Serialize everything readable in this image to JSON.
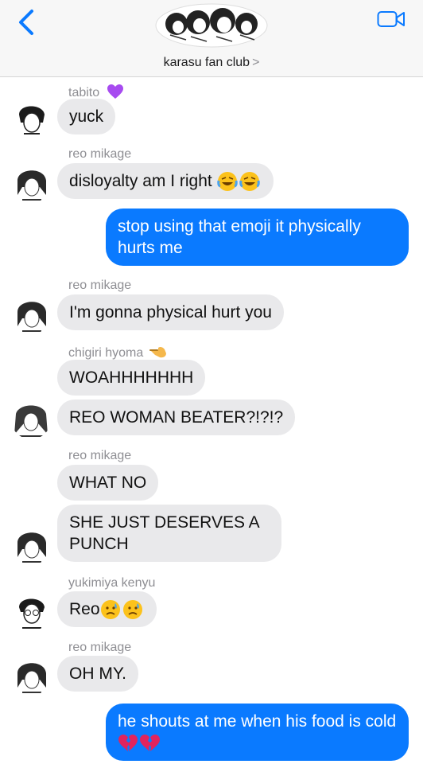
{
  "header": {
    "title": "karasu fan club",
    "chevron": ">",
    "icons": [
      "chevron-left-icon",
      "video-camera-icon"
    ]
  },
  "messages": [
    {
      "sender": "tabito",
      "sender_emoji": "purple-heart",
      "text": "yuck"
    },
    {
      "sender": "reo mikage",
      "text": "disloyalty am I right",
      "emoji": "tears-of-joy x2"
    },
    {
      "outgoing": true,
      "text": "stop using that emoji it physically hurts me"
    },
    {
      "sender": "reo mikage",
      "text": "I'm gonna physical hurt you"
    },
    {
      "sender": "chigiri hyoma",
      "sender_emoji": "pointing-hand",
      "text": "WOAHHHHHHH"
    },
    {
      "text": "REO WOMAN BEATER?!?!?"
    },
    {
      "sender": "reo mikage",
      "text": "WHAT NO"
    },
    {
      "text": "SHE JUST DESERVES A PUNCH"
    },
    {
      "sender": "yukimiya kenyu",
      "text": "Reo",
      "emoji": "sad-face x2"
    },
    {
      "sender": "reo mikage",
      "text": "OH MY."
    },
    {
      "outgoing": true,
      "text": "he shouts at me when his food is cold",
      "emoji": "broken-heart x2"
    }
  ],
  "colors": {
    "outgoing_bubble": "#0a7aff",
    "incoming_bubble": "#e9e9eb",
    "accent": "#0a7aff"
  }
}
